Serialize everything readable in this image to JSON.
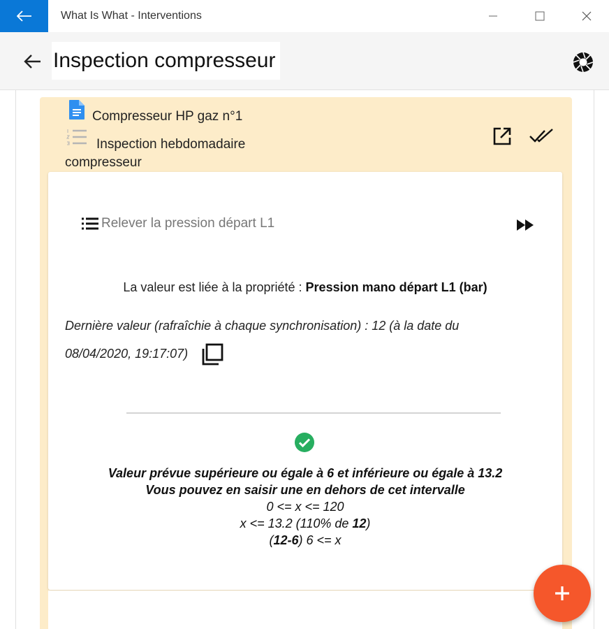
{
  "window": {
    "title": "What Is What - Interventions"
  },
  "header": {
    "title": "Inspection compresseur"
  },
  "card": {
    "equipment": "Compresseur HP gaz n°1",
    "procedure": "Inspection hebdomadaire compresseur",
    "step": {
      "label": "Relever la pression départ L1",
      "property_prefix": "La valeur est liée à la propriété : ",
      "property_name": "Pression mano départ L1 (bar)",
      "last_value_line1": "Dernière valeur (rafraîchie à chaque synchronisation) : 12 (à la date du",
      "last_value_line2": "08/04/2020, 19:17:07)",
      "expected_range": "Valeur prévue supérieure ou égale à 6 et inférieure ou égale à 13.2",
      "out_of_range_hint": "Vous pouvez en saisir une en dehors de cet intervalle",
      "constraint_1": "0 <= x <= 120",
      "constraint_2_prefix": "x <= 13.2 (110% de ",
      "constraint_2_ref": "12",
      "constraint_2_suffix": ")",
      "constraint_3_prefix": "(",
      "constraint_3_ref": "12-6",
      "constraint_3_suffix": ") 6 <= x"
    }
  },
  "fab": {
    "label": "+"
  },
  "colors": {
    "titlebar_accent": "#0a78d7",
    "card_background": "#fdecc9",
    "document_icon": "#2f8ff0",
    "check_ok": "#27ae60",
    "fab": "#f5572b"
  },
  "icons": {
    "titlebar_back": "arrow-left-icon",
    "minimize": "minimize-icon",
    "maximize": "maximize-icon",
    "close": "close-icon",
    "header_back": "arrow-left-icon",
    "camera": "camera-shutter-icon",
    "document": "document-icon",
    "procedure": "numbered-list-icon",
    "open_external": "open-in-new-icon",
    "mark_done": "double-check-icon",
    "step": "list-icon",
    "skip": "fast-forward-icon",
    "copy": "copy-icon",
    "status_ok": "check-circle-icon",
    "fab": "plus-icon"
  }
}
